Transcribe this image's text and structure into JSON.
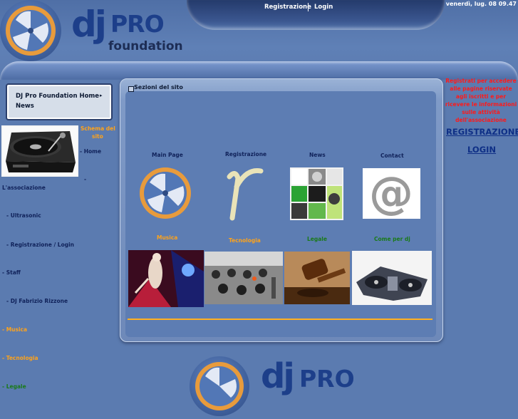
{
  "top_nav": {
    "registrazione": "Registrazione",
    "login": "Login"
  },
  "datetime": "venerdì, lug. 08 09.47",
  "logo": {
    "dj": "dj",
    "pro": "PRO",
    "foundation": "foundation"
  },
  "left_box": {
    "line1": "DJ Pro Foundation Home",
    "line2": "News"
  },
  "left_nav": {
    "schema_line1": "Schema del",
    "schema_line2": "sito",
    "home": "- Home",
    "dash": "-",
    "associazione": "L'associazione",
    "ultrasonic": "- Ultrasonic",
    "reg_login": "- Registrazione / Login",
    "staff": "- Staff",
    "fabrizio": "- DJ Fabrizio Rizzone",
    "musica": "- Musica",
    "tecnologia": "- Tecnologia",
    "legale": "- Legale"
  },
  "panel": {
    "title": "Sezioni del sito",
    "tiles_row1": [
      "Main Page",
      "Registrazione",
      "News",
      "Contact"
    ],
    "tiles_row2": [
      "Musica",
      "Tecnologia",
      "Legale",
      "Come per dj"
    ]
  },
  "right": {
    "info": "Registrati per accedere alle pagine riservate agli iscritti e per ricevere le informazioni sulle attività dell'associazione",
    "registrazione": "REGISTRAZIONE",
    "login": "LOGIN"
  },
  "colors": {
    "background": "#5b7bb0",
    "brand_navy": "#1d3f8a",
    "accent_orange": "#ffa31a",
    "alert_red": "#ff1a1a",
    "nav_green": "#1a7a1a"
  }
}
